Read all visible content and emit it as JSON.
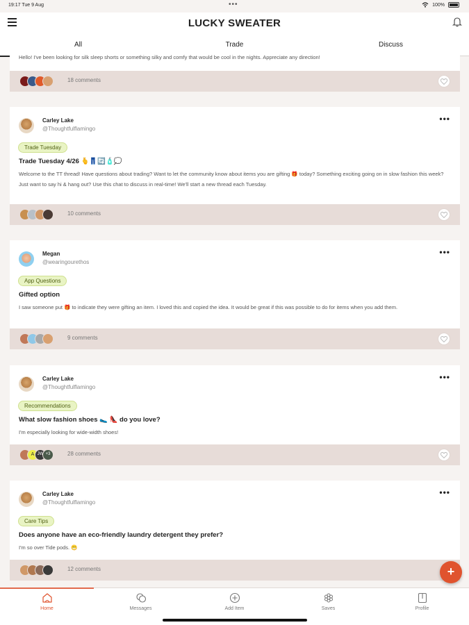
{
  "status_bar": {
    "time": "19:17  Tue 9 Aug",
    "battery": "100%"
  },
  "app": {
    "title": "LUCKY SWEATER"
  },
  "tabs": [
    {
      "label": "All",
      "active": true
    },
    {
      "label": "Trade",
      "active": false
    },
    {
      "label": "Discuss",
      "active": false
    }
  ],
  "cards": [
    {
      "body": "Hello! I've been looking for silk sleep shorts or something silky and comfy that would be cool in the nights. Appreciate any direction!",
      "comments": "18 comments",
      "face_colors": [
        "#7a1a1a",
        "#3a5a8a",
        "#e05a2a",
        "#d8a070"
      ]
    },
    {
      "author": "Carley Lake",
      "handle": "@Thoughtfulflamingo",
      "tag": "Trade Tuesday",
      "title": "Trade Tuesday 4/26 🫰👖🔄🧴💭",
      "body": "Welcome to the TT thread! Have questions about trading? Want to let the community know about items you are gifting 🎁 today? Something exciting going on in slow fashion this week? Just want to say hi & hang out? Use this chat to discuss in real-time! We'll start a new thread each Tuesday.",
      "comments": "10 comments",
      "face_colors": [
        "#c89050",
        "#b8c0c8",
        "#d09868",
        "#4a3a34"
      ]
    },
    {
      "author": "Megan",
      "handle": "@wearingourethos",
      "tag": "App Questions",
      "title": "Gifted option",
      "body": "I saw someone put 🎁 to indicate they were gifting an item. I loved this and copied the idea. It would be great if this was possible to do for items when you add them.",
      "comments": "9 comments",
      "face_colors": [
        "#c07858",
        "#8fc8e8",
        "#a8a8a8",
        "#d8a070"
      ]
    },
    {
      "author": "Carley Lake",
      "handle": "@Thoughtfulflamingo",
      "tag": "Recommendations",
      "title": "What slow fashion shoes 🥿 👠 do you love?",
      "body": "I'm especially looking for wide-width shoes!",
      "comments": "28 comments",
      "faces_text": [
        "",
        "A",
        "JW",
        "+3"
      ],
      "face_colors": [
        "#c07858",
        "#eef04a",
        "#3a3a3a",
        "#4a5a4a"
      ]
    },
    {
      "author": "Carley Lake",
      "handle": "@Thoughtfulflamingo",
      "tag": "Care Tips",
      "title": "Does anyone have an eco-friendly laundry detergent they prefer?",
      "body": "I'm so over Tide pods. 😬",
      "comments": "12 comments",
      "face_colors": [
        "#d09868",
        "#b07850",
        "#8a6a5a",
        "#3a3a3a"
      ]
    }
  ],
  "fab_label": "+",
  "nav": [
    {
      "label": "Home",
      "icon": "home-icon",
      "active": true
    },
    {
      "label": "Messages",
      "icon": "messages-icon",
      "active": false
    },
    {
      "label": "Add Item",
      "icon": "add-item-icon",
      "active": false
    },
    {
      "label": "Saves",
      "icon": "saves-icon",
      "active": false
    },
    {
      "label": "Profile",
      "icon": "profile-icon",
      "active": false
    }
  ],
  "colors": {
    "accent": "#e0532e",
    "tag_bg": "#e9f4c4",
    "footer_bg": "#e7dcd8"
  }
}
